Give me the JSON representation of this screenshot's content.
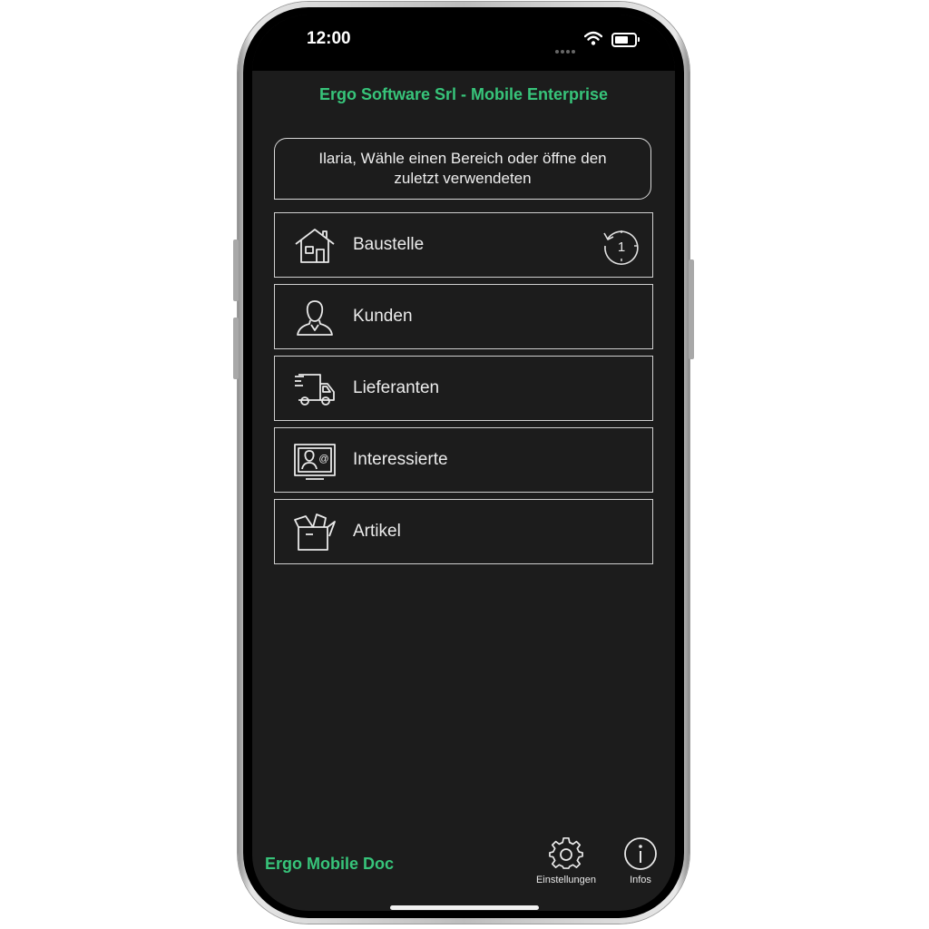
{
  "status_bar": {
    "time": "12:00"
  },
  "header": {
    "title": "Ergo Software Srl - Mobile Enterprise"
  },
  "prompt": {
    "text": "Ilaria, Wähle einen Bereich oder öffne den zuletzt verwendeten"
  },
  "menu": {
    "items": [
      {
        "label": "Baustelle",
        "icon": "house-icon",
        "recent_count": "1"
      },
      {
        "label": "Kunden",
        "icon": "person-icon"
      },
      {
        "label": "Lieferanten",
        "icon": "delivery-truck-icon"
      },
      {
        "label": "Interessierte",
        "icon": "contact-card-icon"
      },
      {
        "label": "Artikel",
        "icon": "box-icon"
      }
    ]
  },
  "footer": {
    "brand": "Ergo Mobile Doc",
    "settings_label": "Einstellungen",
    "info_label": "Infos"
  },
  "colors": {
    "accent": "#37c47a",
    "background": "#1c1c1c",
    "border": "#cfcfcf",
    "text": "#ececec"
  }
}
